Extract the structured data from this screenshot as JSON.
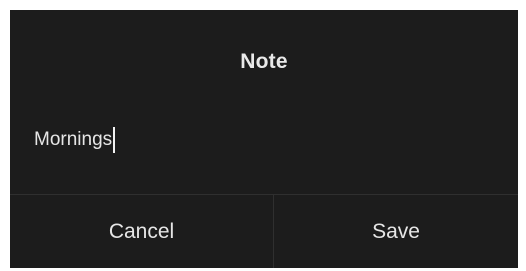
{
  "dialog": {
    "title": "Note",
    "note_value": "Mornings",
    "cancel_label": "Cancel",
    "save_label": "Save"
  },
  "colors": {
    "dialog_background": "#1c1c1c",
    "text": "#e6e6e6",
    "divider": "#2f2f2f"
  }
}
